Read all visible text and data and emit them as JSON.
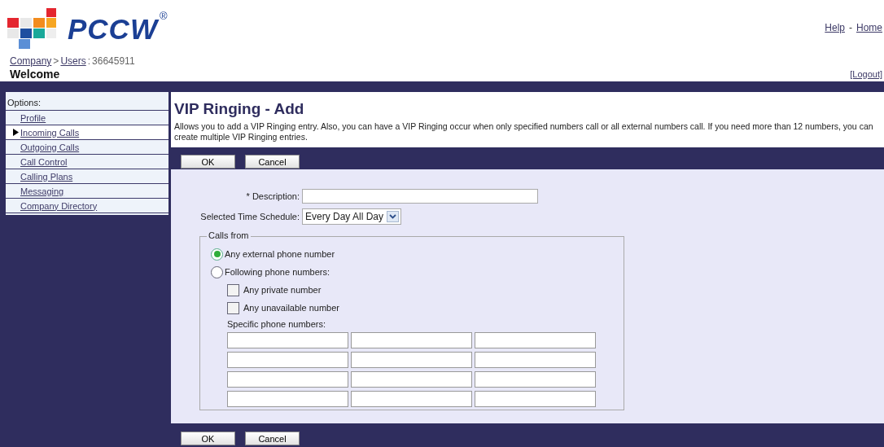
{
  "logo": {
    "text": "PCCW",
    "mark": "®"
  },
  "header_links": [
    {
      "kind": "link",
      "text": "Help"
    },
    {
      "kind": "sep",
      "text": "-"
    },
    {
      "kind": "link",
      "text": "Home"
    }
  ],
  "breadcrumb": [
    {
      "kind": "link",
      "text": "Company"
    },
    {
      "kind": "sep",
      "text": ">"
    },
    {
      "kind": "link",
      "text": "Users"
    },
    {
      "kind": "sep",
      "text": ":"
    },
    {
      "kind": "text",
      "text": "36645911"
    }
  ],
  "welcome": "Welcome",
  "logout": "[Logout]",
  "sidebar": {
    "heading": "Options:",
    "items": [
      {
        "label": "Profile",
        "selected": false
      },
      {
        "label": "Incoming Calls",
        "selected": true
      },
      {
        "label": "Outgoing Calls",
        "selected": false
      },
      {
        "label": "Call Control",
        "selected": false
      },
      {
        "label": "Calling Plans",
        "selected": false
      },
      {
        "label": "Messaging",
        "selected": false
      },
      {
        "label": "Company Directory",
        "selected": false
      }
    ]
  },
  "title": "VIP Ringing - Add",
  "intro": "Allows you to add a VIP Ringing entry. Also, you can have a VIP Ringing occur when only specified numbers call or all external numbers call. If you need more than 12 numbers, you can create multiple VIP Ringing entries.",
  "top_buttons": [
    "OK",
    "Cancel"
  ],
  "form": {
    "description_label": "* Description:",
    "schedule_label": "Selected Time Schedule:",
    "schedule_value": "Every Day All Day",
    "calls_from": {
      "legend": "Calls from",
      "radios": [
        {
          "label": "Any external phone number",
          "selected": true
        },
        {
          "label": "Following phone numbers:",
          "selected": false
        }
      ],
      "checkboxes": [
        {
          "label": "Any private number",
          "checked": false
        },
        {
          "label": "Any unavailable number",
          "checked": false
        }
      ],
      "specific_label": "Specific phone numbers:"
    }
  },
  "bottom_buttons": [
    "OK",
    "Cancel"
  ]
}
